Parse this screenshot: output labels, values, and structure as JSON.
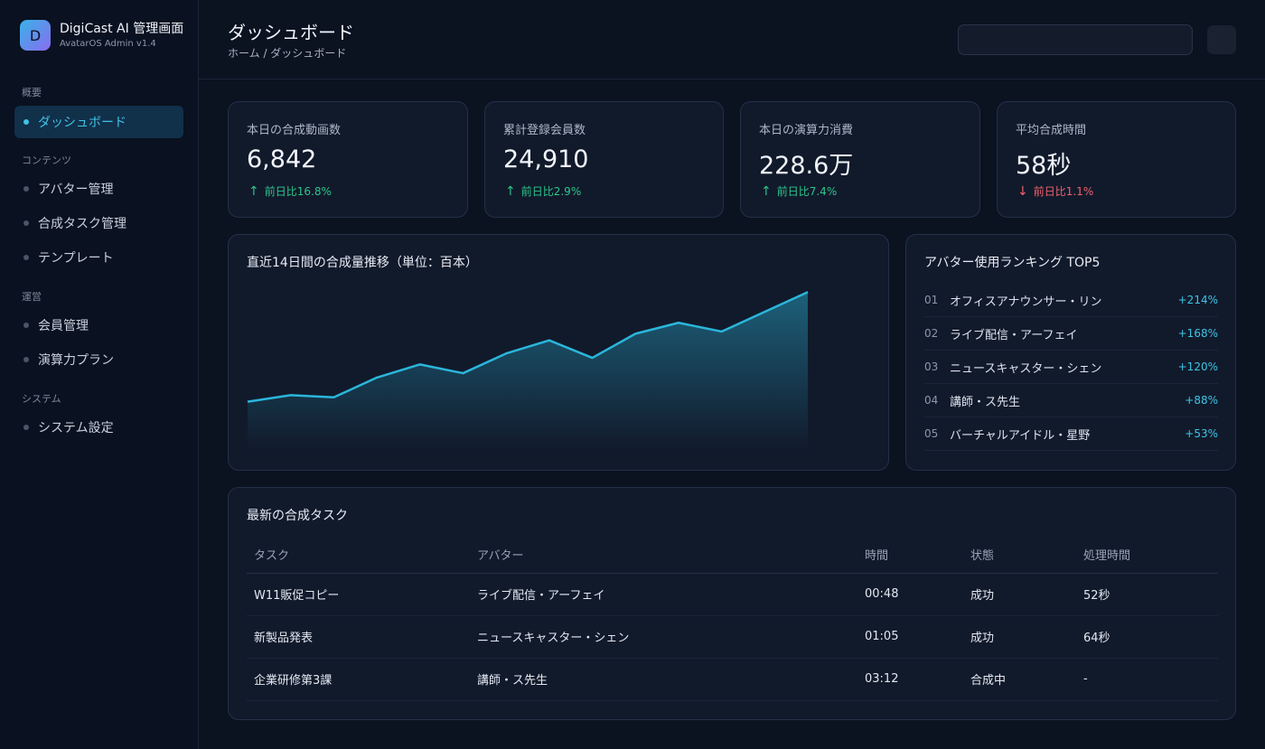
{
  "brand": {
    "logo_letter": "D",
    "title": "DigiCast AI 管理画面",
    "subtitle": "AvatarOS Admin v1.4"
  },
  "sidebar": {
    "sections": [
      {
        "label": "概要"
      },
      {
        "label": "コンテンツ"
      },
      {
        "label": "運営"
      },
      {
        "label": "システム"
      }
    ],
    "items": [
      {
        "label": "ダッシュボード",
        "active": true
      },
      {
        "label": "アバター管理"
      },
      {
        "label": "合成タスク管理"
      },
      {
        "label": "テンプレート"
      },
      {
        "label": "会員管理"
      },
      {
        "label": "演算力プラン"
      },
      {
        "label": "システム設定"
      }
    ]
  },
  "header": {
    "title": "ダッシュボード",
    "breadcrumb": "ホーム / ダッシュボード",
    "search_value": ""
  },
  "stats": [
    {
      "label": "本日の合成動画数",
      "value": "6,842",
      "change": "前日比16.8%",
      "direction": "up",
      "arrow": "↑"
    },
    {
      "label": "累計登録会員数",
      "value": "24,910",
      "change": "前日比2.9%",
      "direction": "up",
      "arrow": "↑"
    },
    {
      "label": "本日の演算力消費",
      "value": "228.6万",
      "change": "前日比7.4%",
      "direction": "up",
      "arrow": "↑"
    },
    {
      "label": "平均合成時間",
      "value": "58秒",
      "change": "前日比1.1%",
      "direction": "down",
      "arrow": "↓"
    }
  ],
  "trend_card": {
    "title": "直近14日間の合成量推移（単位：百本）"
  },
  "chart_data": {
    "type": "area",
    "title": "直近14日間の合成量推移（単位：百本）",
    "x": [
      1,
      2,
      3,
      4,
      5,
      6,
      7,
      8,
      9,
      10,
      11,
      12,
      13,
      14
    ],
    "series": [
      {
        "values": [
          22,
          25,
          24,
          33,
          39,
          35,
          44,
          50,
          42,
          53,
          58,
          54,
          63,
          72
        ]
      }
    ],
    "ylim": [
      0,
      75
    ],
    "grid": false,
    "color": "#2bb6db"
  },
  "ranking": {
    "title": "アバター使用ランキング TOP5",
    "items": [
      {
        "no": "01",
        "name": "オフィスアナウンサー・リン",
        "pct": "+214%"
      },
      {
        "no": "02",
        "name": "ライブ配信・アーフェイ",
        "pct": "+168%"
      },
      {
        "no": "03",
        "name": "ニュースキャスター・シェン",
        "pct": "+120%"
      },
      {
        "no": "04",
        "name": "講師・ス先生",
        "pct": "+88%"
      },
      {
        "no": "05",
        "name": "バーチャルアイドル・星野",
        "pct": "+53%"
      }
    ]
  },
  "tasks": {
    "title": "最新の合成タスク",
    "columns": [
      "タスク",
      "アバター",
      "時間",
      "状態",
      "処理時間"
    ],
    "rows": [
      {
        "task": "W11販促コピー",
        "avatar": "ライブ配信・アーフェイ",
        "time": "00:48",
        "status": "成功",
        "status_type": "success",
        "duration": "52秒"
      },
      {
        "task": "新製品発表",
        "avatar": "ニュースキャスター・シェン",
        "time": "01:05",
        "status": "成功",
        "status_type": "success",
        "duration": "64秒"
      },
      {
        "task": "企業研修第3課",
        "avatar": "講師・ス先生",
        "time": "03:12",
        "status": "合成中",
        "status_type": "progress",
        "duration": "-"
      }
    ]
  },
  "colors": {
    "accent": "#3ec4e6",
    "up": "#2fc58a",
    "down": "#f0616d",
    "in_progress": "#e6a84a"
  }
}
